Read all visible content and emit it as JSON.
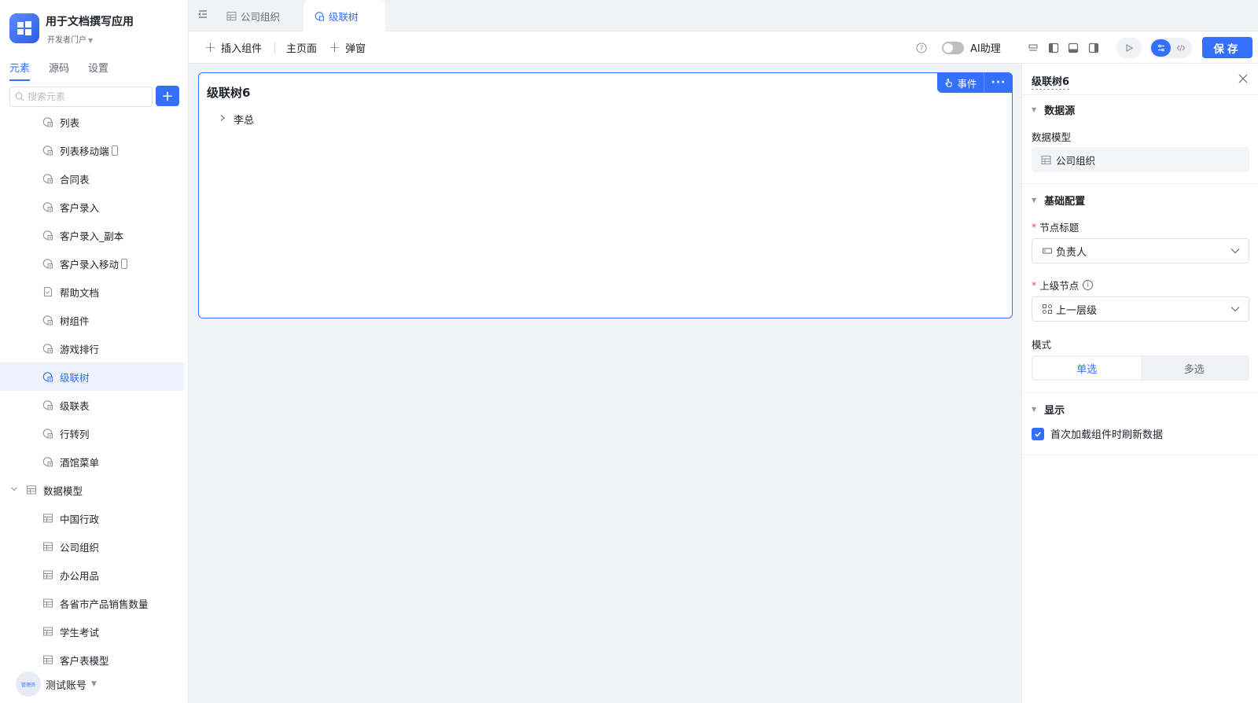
{
  "app": {
    "title": "用于文档撰写应用",
    "subtitle": "开发者门户"
  },
  "sidebar": {
    "tabs": [
      {
        "label": "元素",
        "active": true
      },
      {
        "label": "源码",
        "active": false
      },
      {
        "label": "设置",
        "active": false
      }
    ],
    "search_placeholder": "搜索元素",
    "add_label": "+",
    "items": [
      {
        "label": "列表",
        "icon": "page-icon",
        "mobile": false,
        "selected": false
      },
      {
        "label": "列表移动端",
        "icon": "page-icon",
        "mobile": true,
        "selected": false
      },
      {
        "label": "合同表",
        "icon": "page-icon",
        "mobile": false,
        "selected": false
      },
      {
        "label": "客户录入",
        "icon": "page-icon",
        "mobile": false,
        "selected": false
      },
      {
        "label": "客户录入_副本",
        "icon": "page-icon",
        "mobile": false,
        "selected": false
      },
      {
        "label": "客户录入移动",
        "icon": "page-icon",
        "mobile": true,
        "selected": false
      },
      {
        "label": "帮助文档",
        "icon": "doc-icon",
        "mobile": false,
        "selected": false
      },
      {
        "label": "树组件",
        "icon": "page-icon",
        "mobile": false,
        "selected": false
      },
      {
        "label": "游戏排行",
        "icon": "page-icon",
        "mobile": false,
        "selected": false
      },
      {
        "label": "级联树",
        "icon": "page-icon",
        "mobile": false,
        "selected": true
      },
      {
        "label": "级联表",
        "icon": "page-icon",
        "mobile": false,
        "selected": false
      },
      {
        "label": "行转列",
        "icon": "page-icon",
        "mobile": false,
        "selected": false
      },
      {
        "label": "酒馆菜单",
        "icon": "page-icon",
        "mobile": false,
        "selected": false
      }
    ],
    "group": {
      "label": "数据模型",
      "icon": "table-icon",
      "expanded": true
    },
    "models": [
      {
        "label": "中国行政"
      },
      {
        "label": "公司组织"
      },
      {
        "label": "办公用品"
      },
      {
        "label": "各省市产品销售数量"
      },
      {
        "label": "学生考试"
      },
      {
        "label": "客户表模型"
      }
    ],
    "user": {
      "name": "测试账号",
      "avatar_text": "管理员"
    }
  },
  "tabs": [
    {
      "label": "公司组织",
      "icon": "table-icon",
      "active": false
    },
    {
      "label": "级联树",
      "icon": "page-icon",
      "active": true
    }
  ],
  "toolbar": {
    "insert_label": "插入组件",
    "main_page_label": "主页面",
    "popup_label": "弹窗",
    "ai_label": "AI助理",
    "ai_enabled": false,
    "save_label": "保存"
  },
  "canvas": {
    "widget_title": "级联树6",
    "event_label": "事件",
    "more_label": "···",
    "tree_nodes": [
      {
        "label": "李总",
        "expanded": false
      }
    ]
  },
  "panel": {
    "title": "级联树6",
    "sections": {
      "datasource": "数据源",
      "basic": "基础配置",
      "display": "显示"
    },
    "data_model_label": "数据模型",
    "data_model_value": "公司组织",
    "node_title_label": "节点标题",
    "node_title_value": "负责人",
    "parent_node_label": "上级节点",
    "parent_node_value": "上一层级",
    "mode_label": "模式",
    "mode_options": [
      {
        "label": "单选",
        "active": true
      },
      {
        "label": "多选",
        "active": false
      }
    ],
    "refresh_label": "首次加载组件时刷新数据",
    "refresh_checked": true
  },
  "colors": {
    "accent": "#3370ff",
    "selected_bg": "#eef2fd",
    "required": "#f54a45"
  }
}
